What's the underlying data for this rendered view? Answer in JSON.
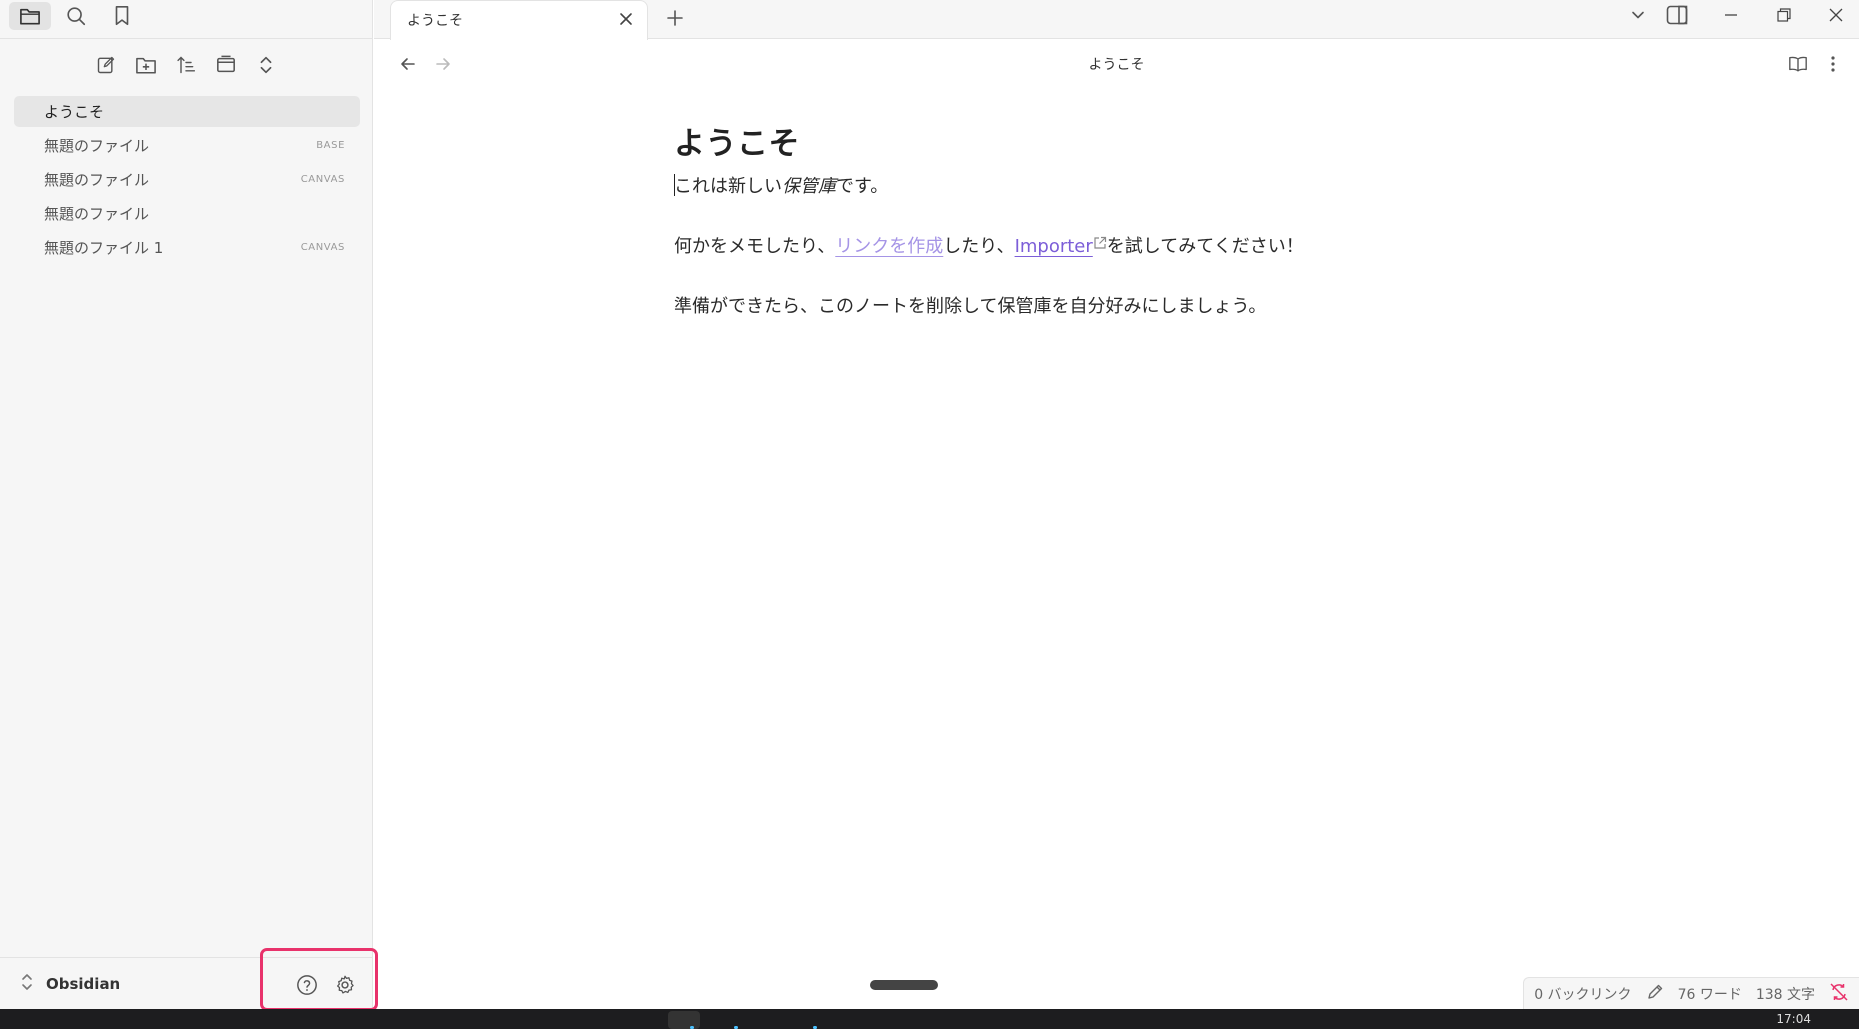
{
  "sidebar": {
    "top_icons": [
      "folder-icon",
      "search-icon",
      "bookmark-icon"
    ],
    "tools": [
      "new-note-icon",
      "new-folder-icon",
      "sort-icon",
      "collapse-icon",
      "expand-icon"
    ],
    "files": [
      {
        "name": "ようこそ",
        "badge": "",
        "active": true
      },
      {
        "name": "無題のファイル",
        "badge": "BASE",
        "active": false
      },
      {
        "name": "無題のファイル",
        "badge": "CANVAS",
        "active": false
      },
      {
        "name": "無題のファイル",
        "badge": "",
        "active": false
      },
      {
        "name": "無題のファイル 1",
        "badge": "CANVAS",
        "active": false
      }
    ],
    "vault_name": "Obsidian"
  },
  "tabbar": {
    "tab_title": "ようこそ"
  },
  "view": {
    "title": "ようこそ"
  },
  "note": {
    "heading": "ようこそ",
    "p1_a": "これは新しい",
    "p1_em": "保管庫",
    "p1_b": "です。",
    "p2_a": "何かをメモしたり、",
    "p2_link": "リンクを作成",
    "p2_b": "したり、",
    "p2_ext_link": "Importer",
    "p2_c": "を試してみてください！",
    "p3": "準備ができたら、このノートを削除して保管庫を自分好みにしましょう。"
  },
  "status": {
    "backlinks": "0 バックリンク",
    "words": "76 ワード",
    "chars": "138 文字"
  },
  "taskbar": {
    "clock": "17:04"
  },
  "colors": {
    "accent_highlight": "#e8326b",
    "internal_link": "#a594e6",
    "external_link": "#7c5ed8",
    "sync_error": "#e8326b"
  }
}
